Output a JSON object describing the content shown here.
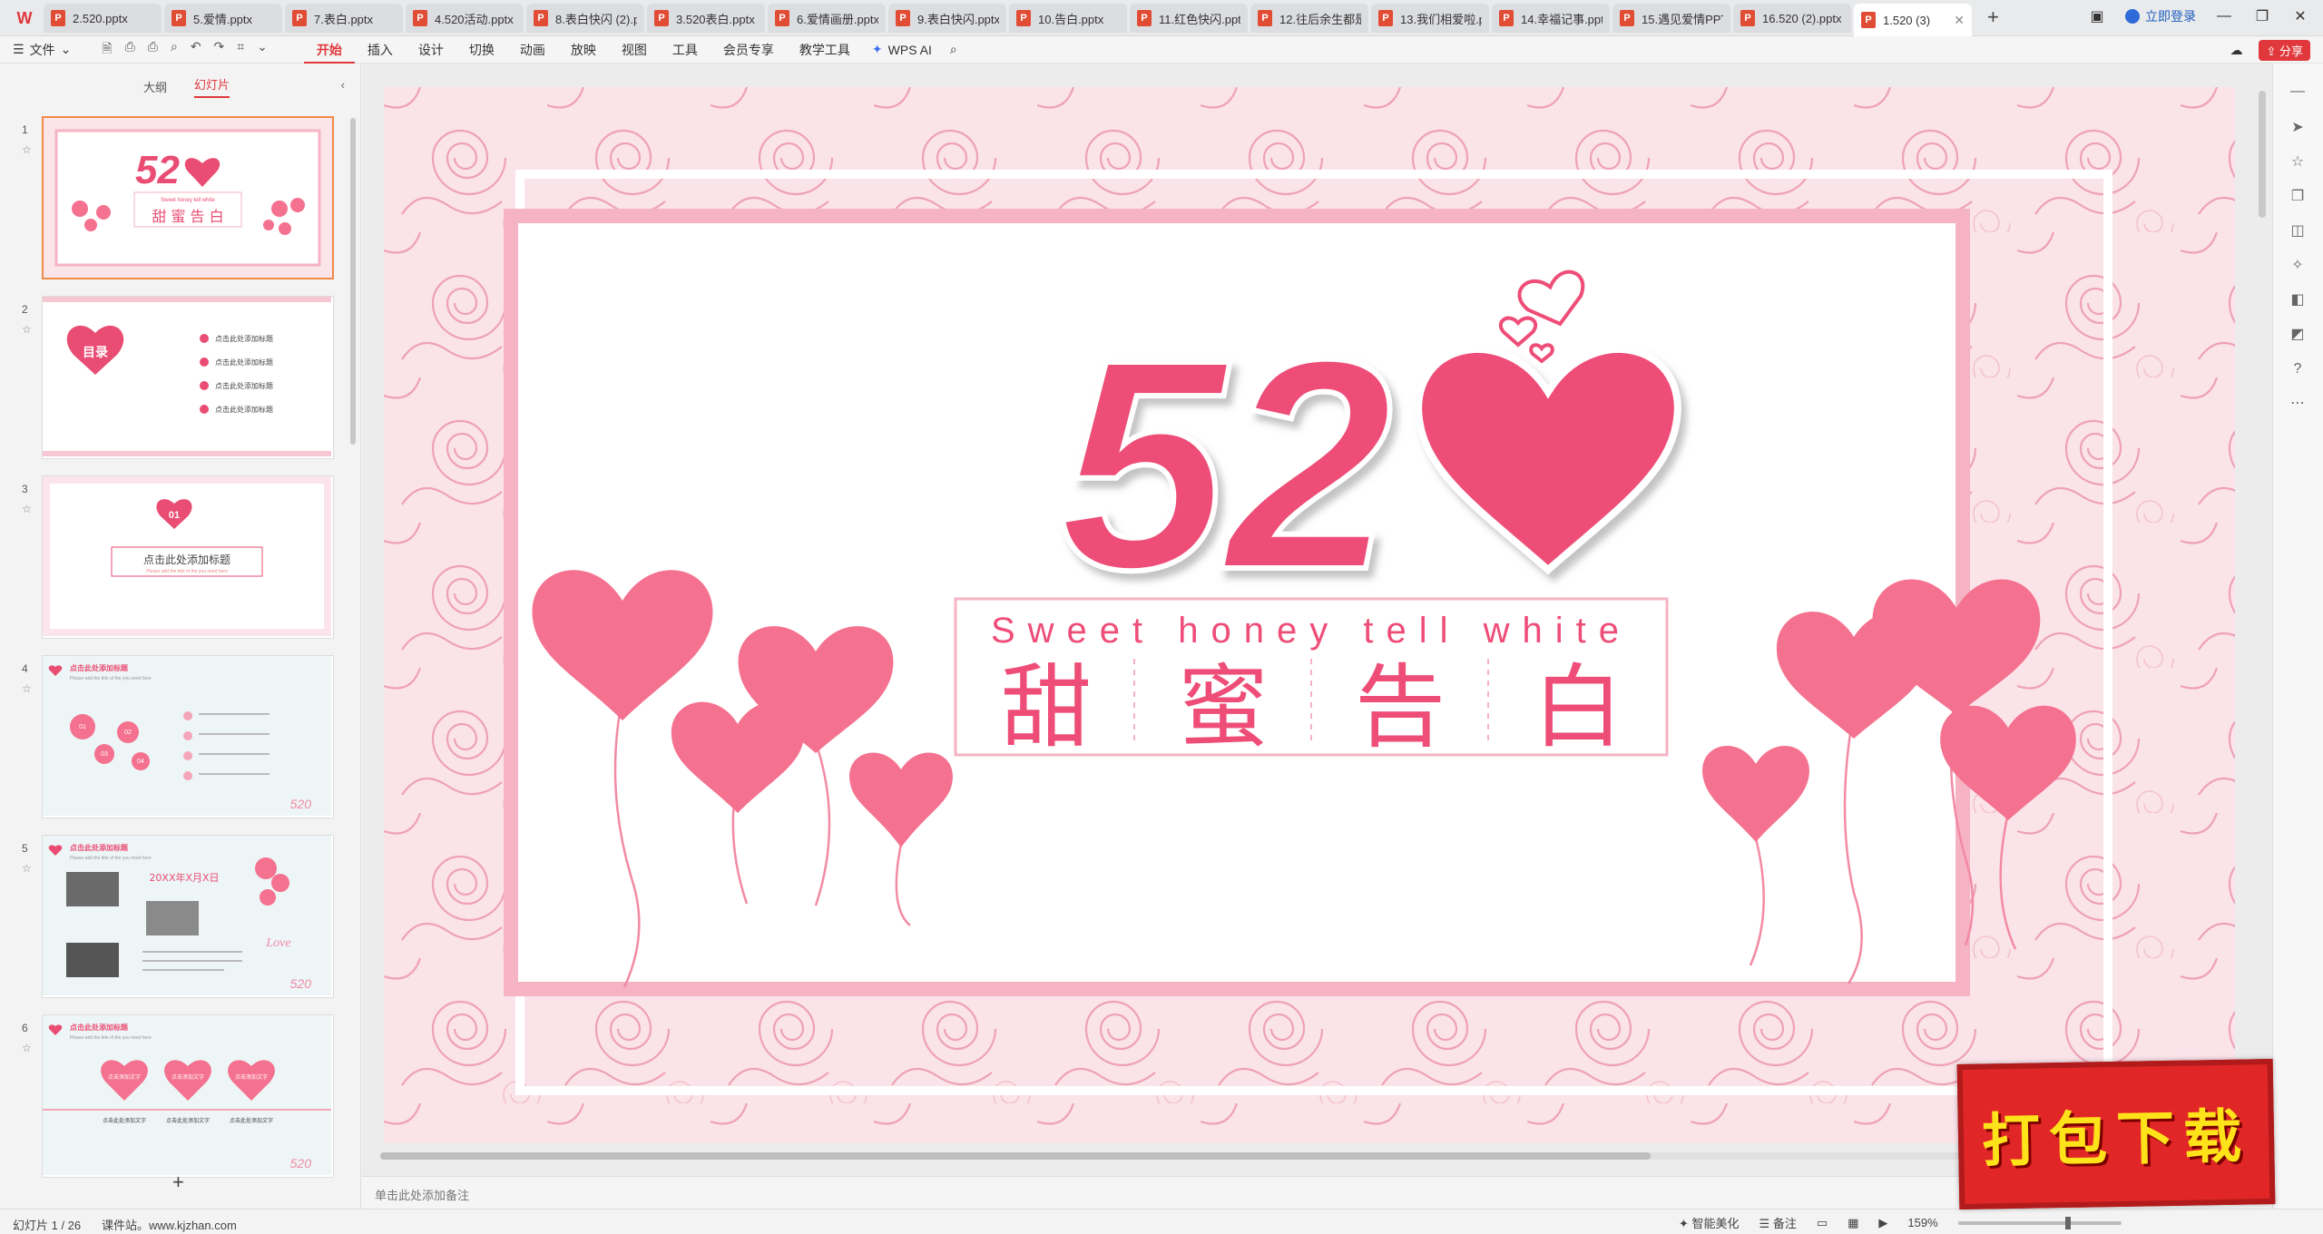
{
  "app": {
    "logo": "W"
  },
  "tabs": [
    {
      "label": "2.520.pptx"
    },
    {
      "label": "5.爱情.pptx"
    },
    {
      "label": "7.表白.pptx"
    },
    {
      "label": "4.520活动.pptx"
    },
    {
      "label": "8.表白快闪 (2).pptx"
    },
    {
      "label": "3.520表白.pptx"
    },
    {
      "label": "6.爱情画册.pptx"
    },
    {
      "label": "9.表白快闪.pptx"
    },
    {
      "label": "10.告白.pptx"
    },
    {
      "label": "11.红色快闪.pptx"
    },
    {
      "label": "12.往后余生都是你.pptx"
    },
    {
      "label": "13.我们相爱啦.pptx"
    },
    {
      "label": "14.幸福记事.pptx"
    },
    {
      "label": "15.遇见爱情PPT"
    },
    {
      "label": "16.520 (2).pptx"
    },
    {
      "label": "1.520 (3)"
    }
  ],
  "titlebar": {
    "login": "立即登录",
    "share": "分享"
  },
  "menu": {
    "file": "文件",
    "tabs": [
      "开始",
      "插入",
      "设计",
      "切换",
      "动画",
      "放映",
      "视图",
      "工具",
      "会员专享",
      "教学工具"
    ],
    "active_tab": "开始",
    "wps_ai": "WPS AI"
  },
  "left_panel": {
    "tabs": [
      "大纲",
      "幻灯片"
    ],
    "active_tab": "幻灯片",
    "thumbnails": [
      {
        "num": "1",
        "title": "52",
        "subtitle": "Sweet honey tell white",
        "cn": "甜 蜜 告 白"
      },
      {
        "num": "2",
        "toc": "目录",
        "items": [
          "点击此处添加标题",
          "点击此处添加标题",
          "点击此处添加标题",
          "点击此处添加标题"
        ]
      },
      {
        "num": "3",
        "badge": "01",
        "title": "点击此处添加标题",
        "sub": "Please add the title of the you need here"
      },
      {
        "num": "4",
        "title": "点击此处添加标题",
        "sub": "Please add the title of the you need here",
        "labels": [
          "01",
          "02",
          "03",
          "04"
        ],
        "mark": "520"
      },
      {
        "num": "5",
        "title": "点击此处添加标题",
        "sub": "Please add the title of the you need here",
        "date": "20XX年X月X日",
        "love": "Love",
        "mark": "520"
      },
      {
        "num": "6",
        "title": "点击此处添加标题",
        "sub": "Please add the title of the you need here",
        "heart_text": "点击添加文字",
        "caption": "点击此处添加文字",
        "mark": "520"
      }
    ]
  },
  "slide": {
    "title": "52",
    "subtitle": "Sweet honey tell white",
    "chars": [
      "甜",
      "蜜",
      "告",
      "白"
    ]
  },
  "notes": {
    "placeholder": "单击此处添加备注"
  },
  "status": {
    "slide_indicator": "幻灯片 1 / 26",
    "site": "课件站。www.kjzhan.com",
    "smart": "智能美化",
    "notes_btn": "备注",
    "zoom": "159%"
  },
  "promo": {
    "text": "打包下载"
  },
  "colors": {
    "accent": "#e0383c",
    "pink": "#ee4d77",
    "balloon": "#f4718f",
    "frame": "#f5b3c3"
  }
}
